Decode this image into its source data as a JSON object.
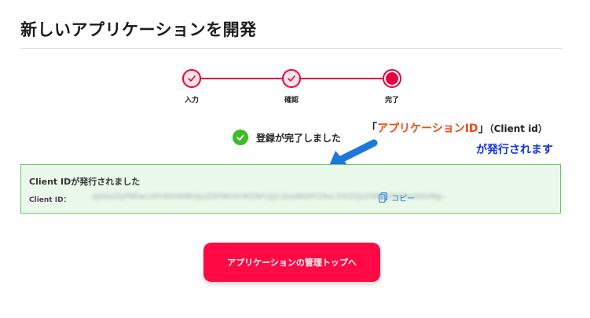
{
  "page": {
    "title": "新しいアプリケーションを開発"
  },
  "stepper": {
    "accent_color": "#e6003d",
    "steps": [
      {
        "label": "入力",
        "state": "done"
      },
      {
        "label": "確認",
        "state": "done"
      },
      {
        "label": "完了",
        "state": "current"
      }
    ]
  },
  "success": {
    "message": "登録が完了しました",
    "icon": "check-circle-icon",
    "color": "#3cbd28"
  },
  "annotation": {
    "open_bracket": "「",
    "highlight": "アプリケーションID",
    "close_bracket": "」",
    "paren": "（Client id）",
    "line2": "が発行されます",
    "highlight_color": "#f04a16",
    "line2_color": "#1434d6",
    "arrow_color": "#1e78d8"
  },
  "client_box": {
    "title": "Client IDが発行されました",
    "label": "Client ID：",
    "value": "dj00aiZpPWlwcz9YdGhWWUpxZ0FWbVlrNlZWYzJ2cjlzaWQ9Y29uc3VtZXJzZWNyZXQmeD0xMg--",
    "copy_label": "コピー",
    "copy_icon": "copy-icon",
    "bg_color": "#eaf8ea",
    "border_color": "#6cc56c"
  },
  "actions": {
    "manage_button_label": "アプリケーションの管理トップへ",
    "button_color": "#ff0a45"
  }
}
